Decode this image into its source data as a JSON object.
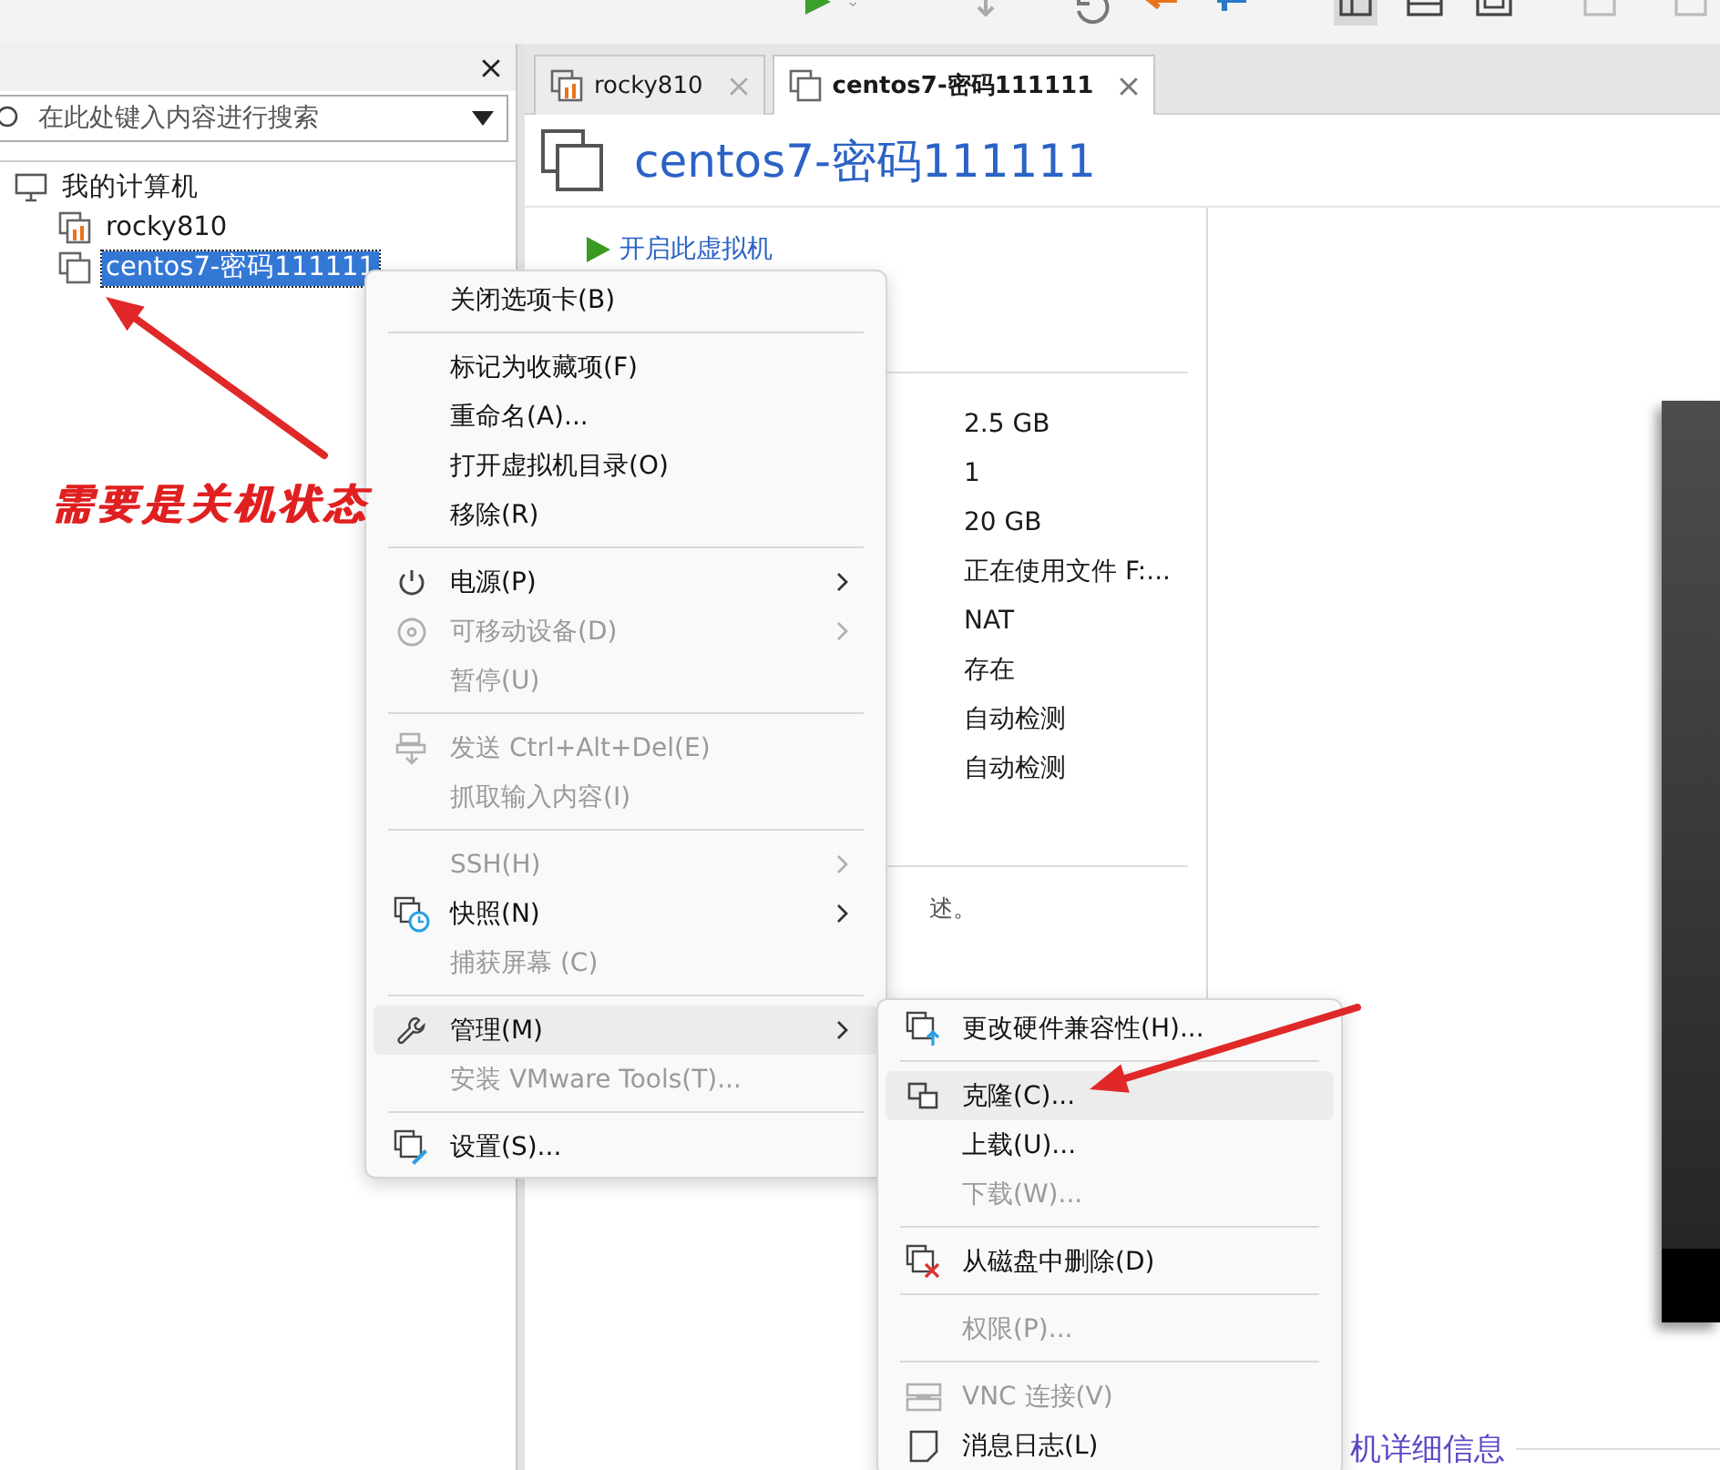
{
  "sidebar": {
    "search": {
      "placeholder": "在此处键入内容进行搜索"
    },
    "tree": [
      {
        "label": "我的计算机",
        "kind": "computer",
        "selected": false,
        "children": [
          {
            "label": "rocky810",
            "kind": "vm-running",
            "selected": false
          },
          {
            "label": "centos7-密码111111",
            "kind": "vm",
            "selected": true
          }
        ]
      }
    ]
  },
  "tabs": [
    {
      "label": "rocky810",
      "kind": "vm-running",
      "selected": false
    },
    {
      "label": "centos7-密码111111",
      "kind": "vm",
      "selected": true
    }
  ],
  "vm": {
    "title": "centos7-密码111111",
    "actions": [
      "开启此虚拟机"
    ],
    "details": [
      "2.5 GB",
      "1",
      "20 GB",
      "正在使用文件 F:...",
      "NAT",
      "存在",
      "自动检测",
      "自动检测"
    ],
    "description": "述。",
    "details_heading": "机详细信息"
  },
  "context_menu": {
    "items": [
      {
        "kind": "item",
        "label": "关闭选项卡(B)",
        "disabled": false,
        "selected": false,
        "submenu": false
      },
      {
        "kind": "separator"
      },
      {
        "kind": "item",
        "label": "标记为收藏项(F)",
        "disabled": false,
        "selected": false,
        "submenu": false
      },
      {
        "kind": "item",
        "label": "重命名(A)...",
        "disabled": false,
        "selected": false,
        "submenu": false
      },
      {
        "kind": "item",
        "label": "打开虚拟机目录(O)",
        "disabled": false,
        "selected": false,
        "submenu": false
      },
      {
        "kind": "item",
        "label": "移除(R)",
        "disabled": false,
        "selected": false,
        "submenu": false
      },
      {
        "kind": "separator"
      },
      {
        "kind": "item",
        "label": "电源(P)",
        "disabled": false,
        "selected": false,
        "submenu": true
      },
      {
        "kind": "item",
        "label": "可移动设备(D)",
        "disabled": true,
        "selected": false,
        "submenu": true
      },
      {
        "kind": "item",
        "label": "暂停(U)",
        "disabled": true,
        "selected": false,
        "submenu": false
      },
      {
        "kind": "separator"
      },
      {
        "kind": "item",
        "label": "发送 Ctrl+Alt+Del(E)",
        "disabled": true,
        "selected": false,
        "submenu": false
      },
      {
        "kind": "item",
        "label": "抓取输入内容(I)",
        "disabled": true,
        "selected": false,
        "submenu": false
      },
      {
        "kind": "separator"
      },
      {
        "kind": "item",
        "label": "SSH(H)",
        "disabled": true,
        "selected": false,
        "submenu": true
      },
      {
        "kind": "item",
        "label": "快照(N)",
        "disabled": false,
        "selected": false,
        "submenu": true
      },
      {
        "kind": "item",
        "label": "捕获屏幕 (C)",
        "disabled": true,
        "selected": false,
        "submenu": false
      },
      {
        "kind": "separator"
      },
      {
        "kind": "item",
        "label": "管理(M)",
        "disabled": false,
        "selected": true,
        "submenu": true
      },
      {
        "kind": "item",
        "label": "安装 VMware Tools(T)...",
        "disabled": true,
        "selected": false,
        "submenu": false
      },
      {
        "kind": "separator"
      },
      {
        "kind": "item",
        "label": "设置(S)...",
        "disabled": false,
        "selected": false,
        "submenu": false
      }
    ]
  },
  "submenu": {
    "items": [
      {
        "kind": "item",
        "label": "更改硬件兼容性(H)...",
        "disabled": false,
        "selected": false,
        "submenu": false
      },
      {
        "kind": "separator"
      },
      {
        "kind": "item",
        "label": "克隆(C)...",
        "disabled": false,
        "selected": true,
        "submenu": false
      },
      {
        "kind": "item",
        "label": "上载(U)...",
        "disabled": false,
        "selected": false,
        "submenu": false
      },
      {
        "kind": "item",
        "label": "下载(W)...",
        "disabled": true,
        "selected": false,
        "submenu": false
      },
      {
        "kind": "separator"
      },
      {
        "kind": "item",
        "label": "从磁盘中删除(D)",
        "disabled": false,
        "selected": false,
        "submenu": false
      },
      {
        "kind": "separator"
      },
      {
        "kind": "item",
        "label": "权限(P)...",
        "disabled": true,
        "selected": false,
        "submenu": false
      },
      {
        "kind": "separator"
      },
      {
        "kind": "item",
        "label": "VNC 连接(V)",
        "disabled": true,
        "selected": false,
        "submenu": false
      },
      {
        "kind": "item",
        "label": "消息日志(L)",
        "disabled": false,
        "selected": false,
        "submenu": false
      }
    ]
  },
  "annotation": {
    "text": "需要是关机状态"
  }
}
